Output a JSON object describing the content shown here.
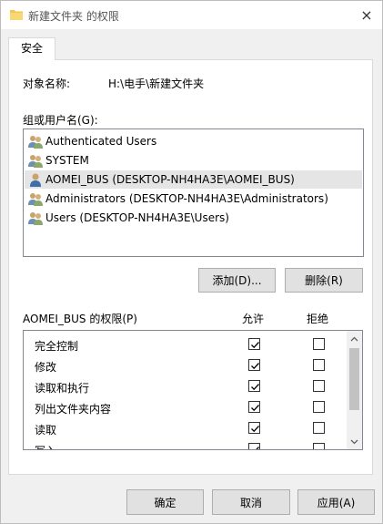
{
  "window": {
    "title": "新建文件夹 的权限",
    "close_icon": "×"
  },
  "tabs": [
    {
      "label": "安全",
      "selected": true
    }
  ],
  "object": {
    "label": "对象名称:",
    "value": "H:\\电手\\新建文件夹"
  },
  "groups": {
    "label": "组或用户名(G):",
    "items": [
      {
        "name": "Authenticated Users",
        "icon": "group-users-icon",
        "selected": false
      },
      {
        "name": "SYSTEM",
        "icon": "group-users-icon",
        "selected": false
      },
      {
        "name": "AOMEI_BUS (DESKTOP-NH4HA3E\\AOMEI_BUS)",
        "icon": "user-icon",
        "selected": true
      },
      {
        "name": "Administrators (DESKTOP-NH4HA3E\\Administrators)",
        "icon": "group-users-icon",
        "selected": false
      },
      {
        "name": "Users (DESKTOP-NH4HA3E\\Users)",
        "icon": "group-users-icon",
        "selected": false
      }
    ]
  },
  "buttons": {
    "add": "添加(D)...",
    "remove": "删除(R)",
    "ok": "确定",
    "cancel": "取消",
    "apply": "应用(A)"
  },
  "permissions": {
    "label": "AOMEI_BUS 的权限(P)",
    "allow_header": "允许",
    "deny_header": "拒绝",
    "rows": [
      {
        "name": "完全控制",
        "allow": true,
        "deny": false
      },
      {
        "name": "修改",
        "allow": true,
        "deny": false
      },
      {
        "name": "读取和执行",
        "allow": true,
        "deny": false
      },
      {
        "name": "列出文件夹内容",
        "allow": true,
        "deny": false
      },
      {
        "name": "读取",
        "allow": true,
        "deny": false
      },
      {
        "name": "写入",
        "allow": true,
        "deny": false
      }
    ]
  },
  "colors": {
    "selection": "#e5e5e5",
    "button_face": "#e1e1e1",
    "folder": "#f2c84b"
  }
}
